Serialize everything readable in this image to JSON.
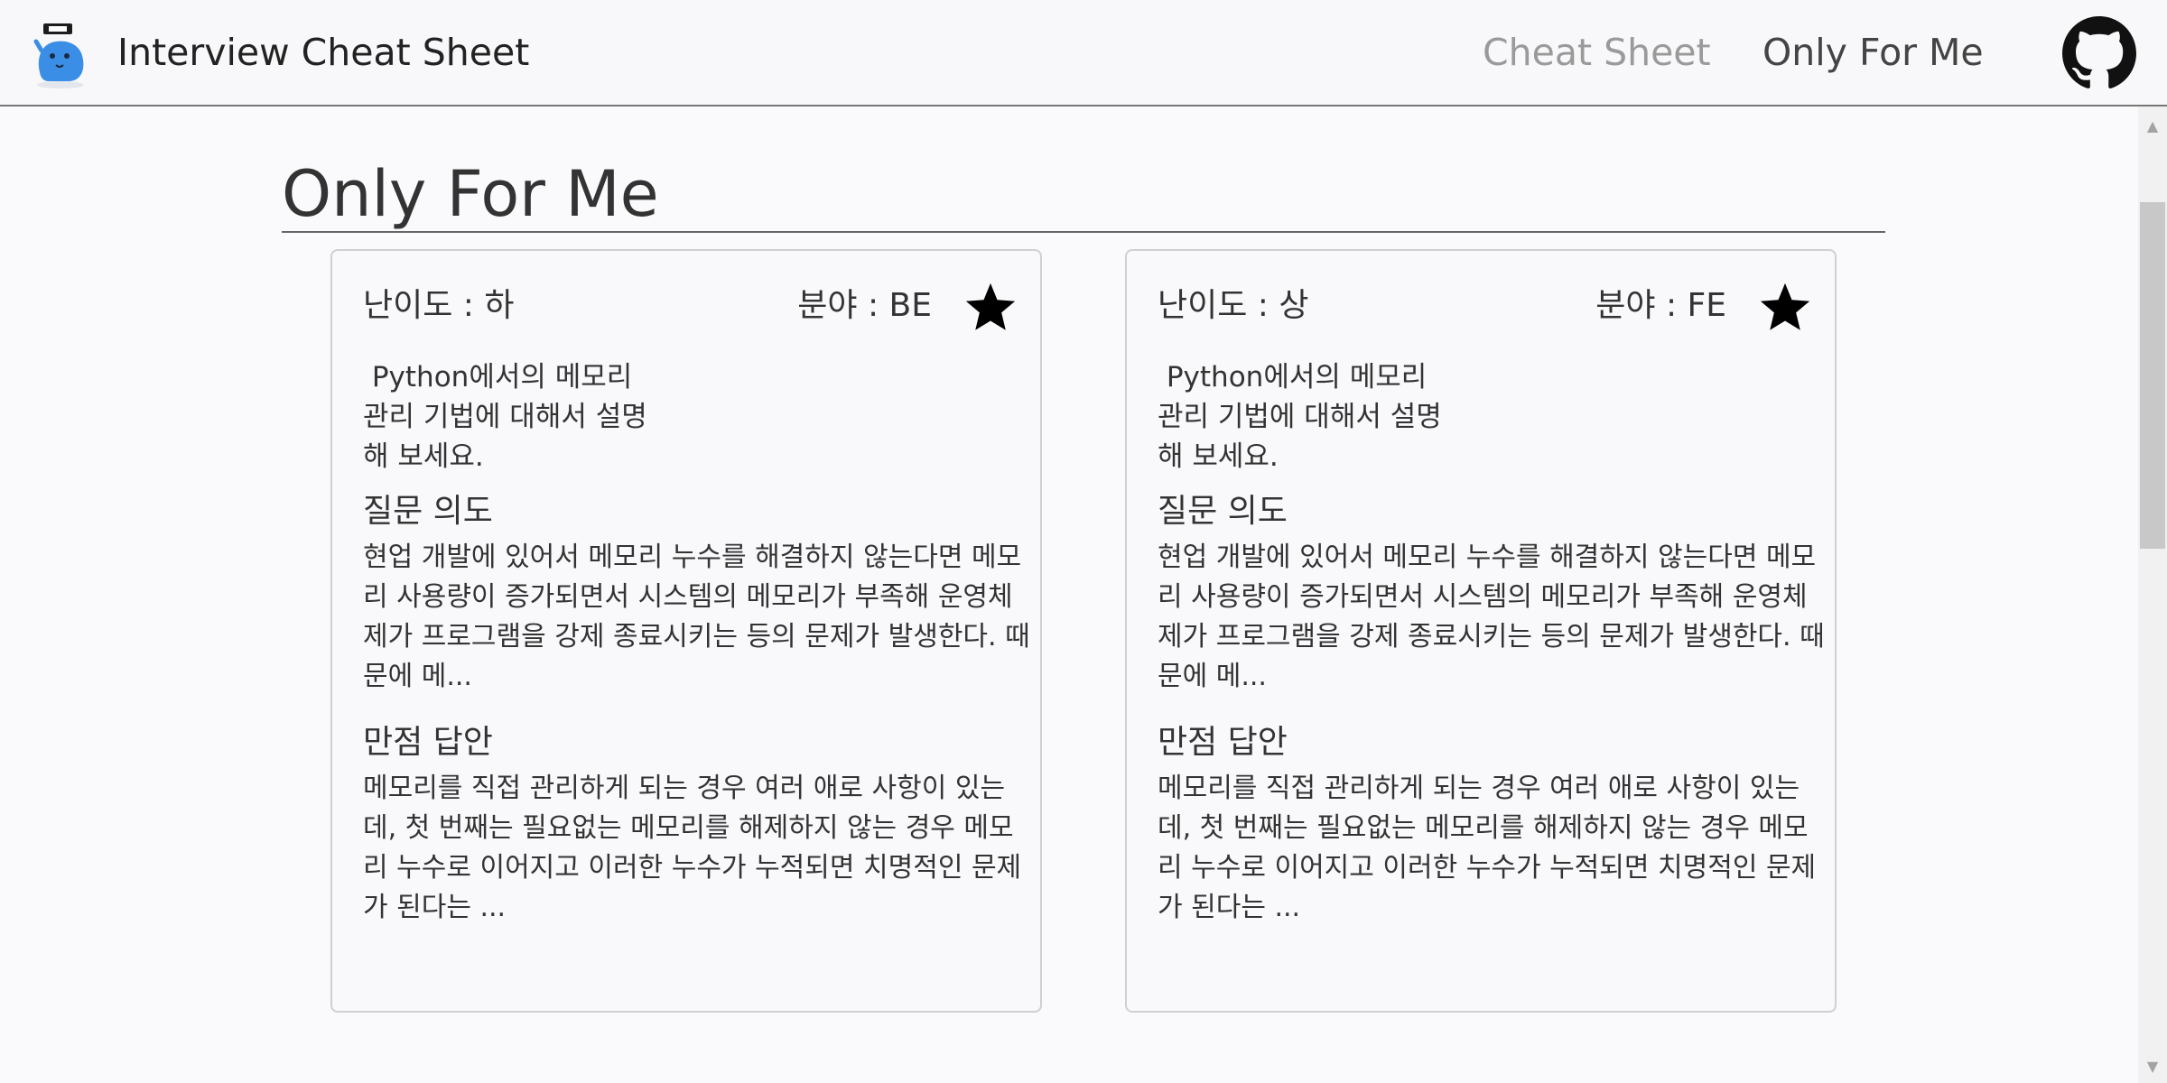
{
  "header": {
    "app_title": "Interview Cheat Sheet",
    "nav": [
      {
        "label": "Cheat Sheet",
        "active": false
      },
      {
        "label": "Only For Me",
        "active": true
      }
    ],
    "logo_icon": "mascot-logo-icon",
    "github_icon": "github-icon"
  },
  "main": {
    "page_title": "Only For Me",
    "cards": [
      {
        "level": "난이도 : 하",
        "field": "분야 : BE",
        "starred": true,
        "question": " Python에서의 메모리\n관리 기법에 대해서 설명\n해 보세요.",
        "intent_heading": "질문 의도",
        "intent_body": "현업 개발에 있어서 메모리 누수를 해결하지 않는다면 메모리 사용량이 증가되면서 시스템의 메모리가 부족해 운영체제가 프로그램을 강제 종료시키는 등의 문제가 발생한다. 때문에 메...",
        "answer_heading": "만점 답안",
        "answer_body": "메모리를 직접 관리하게 되는 경우 여러 애로 사항이 있는데, 첫 번째는 필요없는 메모리를 해제하지 않는 경우 메모리 누수로 이어지고 이러한 누수가 누적되면 치명적인 문제가 된다는 ..."
      },
      {
        "level": "난이도 : 상",
        "field": "분야 : FE",
        "starred": true,
        "question": " Python에서의 메모리\n관리 기법에 대해서 설명\n해 보세요.",
        "intent_heading": "질문 의도",
        "intent_body": "현업 개발에 있어서 메모리 누수를 해결하지 않는다면 메모리 사용량이 증가되면서 시스템의 메모리가 부족해 운영체제가 프로그램을 강제 종료시키는 등의 문제가 발생한다. 때문에 메...",
        "answer_heading": "만점 답안",
        "answer_body": "메모리를 직접 관리하게 되는 경우 여러 애로 사항이 있는데, 첫 번째는 필요없는 메모리를 해제하지 않는 경우 메모리 누수로 이어지고 이러한 누수가 누적되면 치명적인 문제가 된다는 ..."
      }
    ]
  },
  "colors": {
    "background": "#fafafc",
    "nav_inactive": "#9a9a9a",
    "nav_active": "#444444",
    "mascot_blue": "#3a8ee6"
  }
}
